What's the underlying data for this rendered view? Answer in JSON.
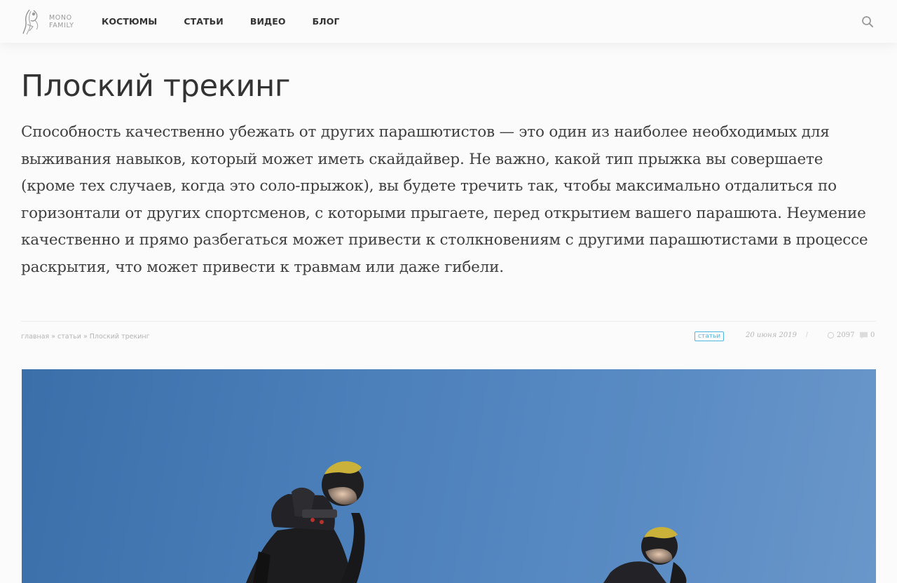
{
  "header": {
    "logo_text_line1": "MONO",
    "logo_text_line2": "FAMILY",
    "nav": [
      {
        "label": "КОСТЮМЫ"
      },
      {
        "label": "СТАТЬИ"
      },
      {
        "label": "ВИДЕО"
      },
      {
        "label": "БЛОГ"
      }
    ],
    "search_icon": "search-icon"
  },
  "article": {
    "title": "Плоский трекинг",
    "lead": "Способность качественно убежать от других парашютистов — это один из наиболее необходимых для выживания навыков, который может иметь скайдайвер. Не важно, какой тип прыжка вы совершаете (кроме тех случаев, когда это соло-прыжок), вы будете тречить так, чтобы максимально отдалиться по горизонтали от других спортсменов, с которыми прыгаете, перед открытием вашего парашюта. Неумение качественно и прямо разбегаться может привести к столкновениям с другими парашютистами в процессе раскрытия, что может привести к травмам или даже гибели."
  },
  "meta": {
    "breadcrumb": [
      "главная",
      "статьи",
      "Плоский трекинг"
    ],
    "breadcrumb_sep": "»",
    "tag": "статьи",
    "date": "20 июня 2019",
    "slash": "/",
    "views": "2097",
    "comments": "0"
  },
  "colors": {
    "accent": "#4fb8e0",
    "sky": "#4c80bb",
    "text": "#333333"
  }
}
